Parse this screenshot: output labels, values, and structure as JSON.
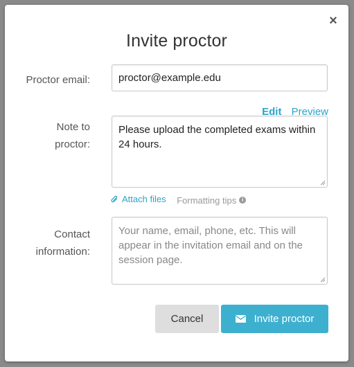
{
  "modal": {
    "title": "Invite proctor",
    "close_icon": "close-icon"
  },
  "email": {
    "label": "Proctor email:",
    "value": "proctor@example.edu"
  },
  "note": {
    "label_line1": "Note to",
    "label_line2": "proctor:",
    "tabs": [
      {
        "label": "Edit",
        "active": true
      },
      {
        "label": "Preview",
        "active": false
      }
    ],
    "value": "Please upload the completed exams within 24 hours."
  },
  "attachments": {
    "attach_label": "Attach files",
    "attach_icon": "paperclip-icon",
    "tips_label": "Formatting tips",
    "tips_icon": "info-icon"
  },
  "contact": {
    "label_line1": "Contact",
    "label_line2": "information:",
    "placeholder": "Your name, email, phone, etc. This will appear in the invitation email and on the session page."
  },
  "actions": {
    "cancel_label": "Cancel",
    "invite_label": "Invite proctor",
    "invite_icon": "envelope-icon"
  },
  "colors": {
    "accent": "#3db0cf",
    "link": "#2aa4c9",
    "cancel_bg": "#dedede"
  }
}
